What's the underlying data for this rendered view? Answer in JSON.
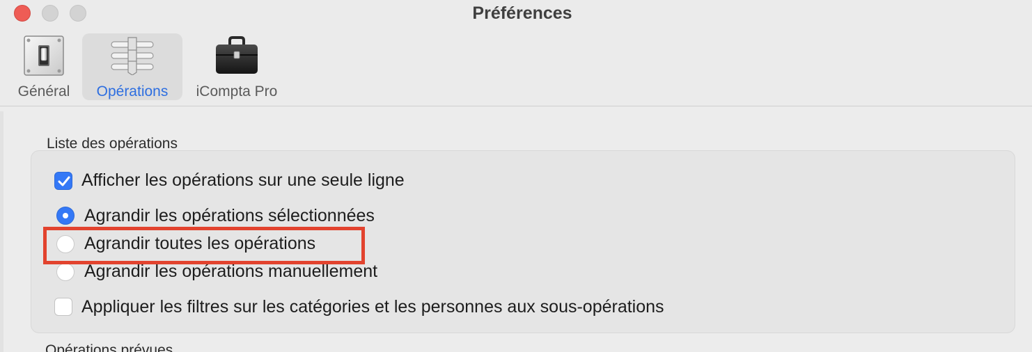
{
  "window": {
    "title": "Préférences"
  },
  "tabs": [
    {
      "label": "Général",
      "icon": "switch-plate-icon",
      "active": false
    },
    {
      "label": "Opérations",
      "icon": "sliders-icon",
      "active": true
    },
    {
      "label": "iCompta Pro",
      "icon": "briefcase-icon",
      "active": false
    }
  ],
  "operations_list": {
    "section_title": "Liste des opérations",
    "single_line": {
      "label": "Afficher les opérations sur une seule ligne",
      "checked": true
    },
    "expand_options": [
      {
        "label": "Agrandir les opérations sélectionnées",
        "selected": true
      },
      {
        "label": "Agrandir toutes les opérations",
        "selected": false
      },
      {
        "label": "Agrandir les opérations manuellement",
        "selected": false
      }
    ],
    "apply_filters": {
      "label": "Appliquer les filtres sur les catégories et les personnes aux sous-opérations",
      "checked": false
    }
  },
  "next_section": {
    "title": "Opérations prévues"
  },
  "colors": {
    "accent": "#3478f6",
    "highlight": "#e2432e",
    "close_button": "#ee5c55"
  }
}
